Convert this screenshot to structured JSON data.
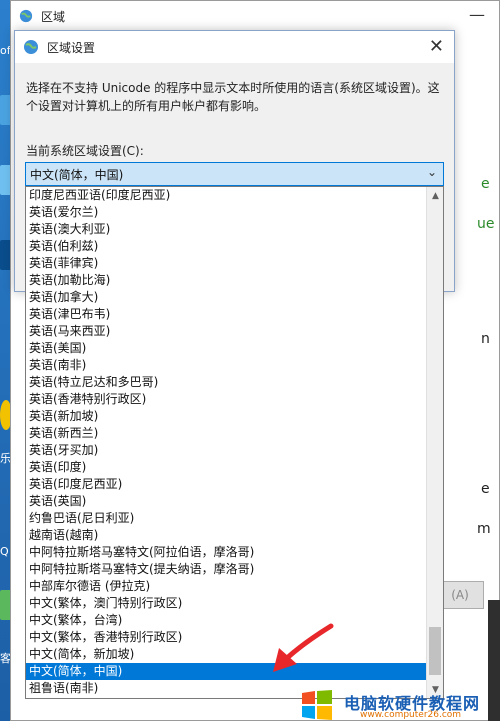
{
  "back_window": {
    "title": "区域",
    "min_glyph": "—",
    "side_glyphs": [
      "e",
      "ue",
      "n",
      "e",
      "m"
    ],
    "apply_button": "(A)"
  },
  "desktop": {
    "labels": [
      "of",
      "Q",
      "乐",
      "客户"
    ]
  },
  "dialog": {
    "title": "区域设置",
    "close_glyph": "✕",
    "description": "选择在不支持 Unicode 的程序中显示文本时所使用的语言(系统区域设置)。这个设置对计算机上的所有用户帐户都有影响。",
    "current_label": "当前系统区域设置(C):"
  },
  "combo": {
    "value": "中文(简体，中国)",
    "arrow": "⌄"
  },
  "list": {
    "selected_index": 29,
    "scroll_up": "▲",
    "scroll_down": "▼",
    "items": [
      "印度尼西亚语(印度尼西亚)",
      "英语(爱尔兰)",
      "英语(澳大利亚)",
      "英语(伯利兹)",
      "英语(菲律宾)",
      "英语(加勒比海)",
      "英语(加拿大)",
      "英语(津巴布韦)",
      "英语(马来西亚)",
      "英语(美国)",
      "英语(南非)",
      "英语(特立尼达和多巴哥)",
      "英语(香港特别行政区)",
      "英语(新加坡)",
      "英语(新西兰)",
      "英语(牙买加)",
      "英语(印度)",
      "英语(印度尼西亚)",
      "英语(英国)",
      "约鲁巴语(尼日利亚)",
      "越南语(越南)",
      "中阿特拉斯塔马塞特文(阿拉伯语，摩洛哥)",
      "中阿特拉斯塔马塞特文(提夫纳语，摩洛哥)",
      "中部库尔德语 (伊拉克)",
      "中文(繁体，澳门特别行政区)",
      "中文(繁体，台湾)",
      "中文(繁体，香港特别行政区)",
      "中文(简体，新加坡)",
      "中文(简体，中国)",
      "祖鲁语(南非)"
    ]
  },
  "watermark": {
    "brand": "电脑软硬件教程网",
    "url": "www.computer26.com"
  },
  "colors": {
    "selection": "#0078d7",
    "combo_bg": "#cce4f7",
    "annotation": "#e8272b"
  }
}
